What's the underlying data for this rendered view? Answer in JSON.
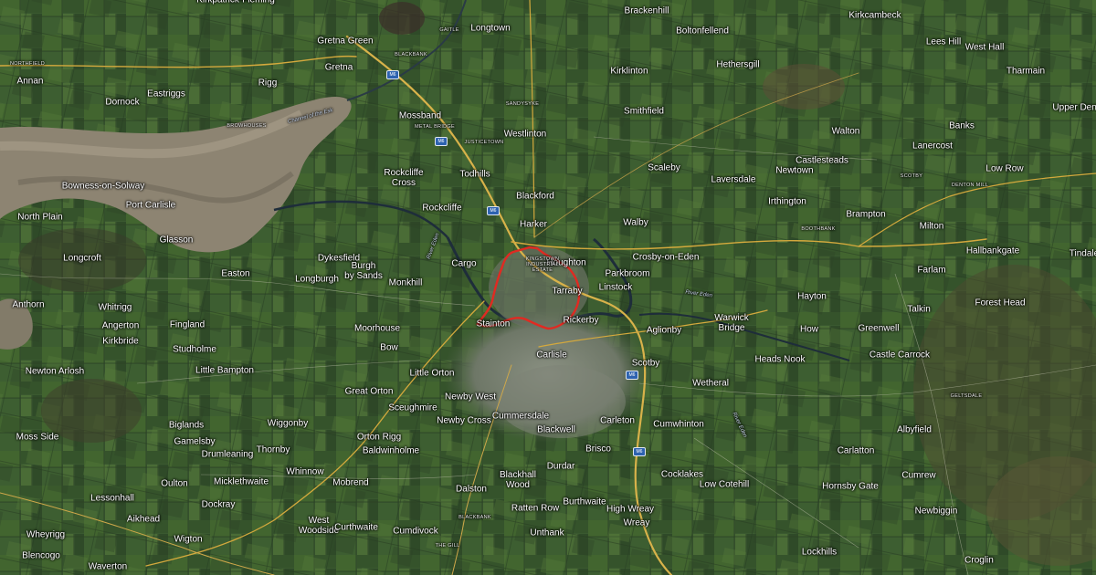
{
  "map": {
    "type": "satellite",
    "colors": {
      "land": "#3b5a32",
      "estuary": "#8c8271",
      "urban": "#7b8275",
      "river": "#1e2d3a",
      "road": "#d8b24a",
      "motorway_shield": "#2d62b0",
      "boundary": "#e02a22"
    },
    "labels": [
      {
        "id": "kirkpatrick-fleming",
        "text": "Kirkpatrick-Fleming"
      },
      {
        "id": "brackenhill",
        "text": "Brackenhill"
      },
      {
        "id": "kirkcambeck",
        "text": "Kirkcambeck"
      },
      {
        "id": "gretna-green",
        "text": "Gretna Green"
      },
      {
        "id": "longtown",
        "text": "Longtown"
      },
      {
        "id": "boltonfellend",
        "text": "Boltonfellend"
      },
      {
        "id": "lees-hill",
        "text": "Lees Hill"
      },
      {
        "id": "west-hall",
        "text": "West Hall"
      },
      {
        "id": "annan",
        "text": "Annan"
      },
      {
        "id": "gretna",
        "text": "Gretna"
      },
      {
        "id": "kirklinton",
        "text": "Kirklinton"
      },
      {
        "id": "hethersgill",
        "text": "Hethersgill"
      },
      {
        "id": "tharmain",
        "text": "Tharmain"
      },
      {
        "id": "dornock",
        "text": "Dornock"
      },
      {
        "id": "eastriggs",
        "text": "Eastriggs"
      },
      {
        "id": "rigg",
        "text": "Rigg"
      },
      {
        "id": "mossband",
        "text": "Mossband"
      },
      {
        "id": "smithfield",
        "text": "Smithfield"
      },
      {
        "id": "upper-dent",
        "text": "Upper Dent"
      },
      {
        "id": "walton",
        "text": "Walton"
      },
      {
        "id": "banks",
        "text": "Banks"
      },
      {
        "id": "westlinton",
        "text": "Westlinton"
      },
      {
        "id": "lanercost",
        "text": "Lanercost"
      },
      {
        "id": "castlesteads",
        "text": "Castlesteads"
      },
      {
        "id": "todhills",
        "text": "Todhills"
      },
      {
        "id": "scaleby",
        "text": "Scaleby"
      },
      {
        "id": "newtown",
        "text": "Newtown"
      },
      {
        "id": "low-row",
        "text": "Low Row"
      },
      {
        "id": "rockcliffe-cross",
        "text": "Rockcliffe\nCross"
      },
      {
        "id": "laversdale",
        "text": "Laversdale"
      },
      {
        "id": "bowness-on-solway",
        "text": "Bowness-on-Solway"
      },
      {
        "id": "blackford",
        "text": "Blackford"
      },
      {
        "id": "irthington",
        "text": "Irthington"
      },
      {
        "id": "port-carlisle",
        "text": "Port Carlisle"
      },
      {
        "id": "rockcliffe",
        "text": "Rockcliffe"
      },
      {
        "id": "north-plain",
        "text": "North Plain"
      },
      {
        "id": "harker",
        "text": "Harker"
      },
      {
        "id": "walby",
        "text": "Walby"
      },
      {
        "id": "brampton",
        "text": "Brampton"
      },
      {
        "id": "milton",
        "text": "Milton"
      },
      {
        "id": "glasson",
        "text": "Glasson"
      },
      {
        "id": "hallbankgate",
        "text": "Hallbankgate"
      },
      {
        "id": "tindale",
        "text": "Tindale"
      },
      {
        "id": "longcroft",
        "text": "Longcroft"
      },
      {
        "id": "dykesfield",
        "text": "Dykesfield"
      },
      {
        "id": "cargo",
        "text": "Cargo"
      },
      {
        "id": "houghton",
        "text": "Houghton"
      },
      {
        "id": "crosby-on-eden",
        "text": "Crosby-on-Eden"
      },
      {
        "id": "easton",
        "text": "Easton"
      },
      {
        "id": "longburgh",
        "text": "Longburgh"
      },
      {
        "id": "burgh-by-sands",
        "text": "Burgh\nby Sands"
      },
      {
        "id": "parkbroom",
        "text": "Parkbroom"
      },
      {
        "id": "farlam",
        "text": "Farlam"
      },
      {
        "id": "monkhill",
        "text": "Monkhill"
      },
      {
        "id": "linstock",
        "text": "Linstock"
      },
      {
        "id": "tarraby",
        "text": "Tarraby"
      },
      {
        "id": "hayton",
        "text": "Hayton"
      },
      {
        "id": "anthorn",
        "text": "Anthorn"
      },
      {
        "id": "whitrigg",
        "text": "Whitrigg"
      },
      {
        "id": "talkin",
        "text": "Talkin"
      },
      {
        "id": "forest-head",
        "text": "Forest Head"
      },
      {
        "id": "angerton",
        "text": "Angerton"
      },
      {
        "id": "fingland",
        "text": "Fingland"
      },
      {
        "id": "stainton",
        "text": "Stainton"
      },
      {
        "id": "rickerby",
        "text": "Rickerby"
      },
      {
        "id": "warwick-bridge",
        "text": "Warwick\nBridge"
      },
      {
        "id": "how",
        "text": "How"
      },
      {
        "id": "greenwell",
        "text": "Greenwell"
      },
      {
        "id": "moorhouse",
        "text": "Moorhouse"
      },
      {
        "id": "aglionby",
        "text": "Aglionby"
      },
      {
        "id": "kirkbride",
        "text": "Kirkbride"
      },
      {
        "id": "carlisle",
        "text": "Carlisle"
      },
      {
        "id": "studholme",
        "text": "Studholme"
      },
      {
        "id": "bow",
        "text": "Bow"
      },
      {
        "id": "castle-carrock",
        "text": "Castle Carrock"
      },
      {
        "id": "heads-nook",
        "text": "Heads Nook"
      },
      {
        "id": "scotby",
        "text": "Scotby"
      },
      {
        "id": "little-bampton",
        "text": "Little Bampton"
      },
      {
        "id": "newton-arlosh",
        "text": "Newton Arlosh"
      },
      {
        "id": "little-orton",
        "text": "Little Orton"
      },
      {
        "id": "wetheral",
        "text": "Wetheral"
      },
      {
        "id": "great-orton",
        "text": "Great Orton"
      },
      {
        "id": "newby-west",
        "text": "Newby West"
      },
      {
        "id": "scuggimire",
        "text": "Sceughmire"
      },
      {
        "id": "cummersdale",
        "text": "Cummersdale"
      },
      {
        "id": "newby-cross",
        "text": "Newby Cross"
      },
      {
        "id": "carleton",
        "text": "Carleton"
      },
      {
        "id": "bigands",
        "text": "Biglands"
      },
      {
        "id": "wiggonby",
        "text": "Wiggonby"
      },
      {
        "id": "blackwell",
        "text": "Blackwell"
      },
      {
        "id": "cumwhinton",
        "text": "Cumwhinton"
      },
      {
        "id": "albyfield",
        "text": "Albyfield"
      },
      {
        "id": "moss-side",
        "text": "Moss Side"
      },
      {
        "id": "orton-rigg",
        "text": "Orton Rigg"
      },
      {
        "id": "gamelsby",
        "text": "Gamelsby"
      },
      {
        "id": "thornby",
        "text": "Thornby"
      },
      {
        "id": "baldwinholme",
        "text": "Baldwinholme"
      },
      {
        "id": "brisco",
        "text": "Brisco"
      },
      {
        "id": "carlatton",
        "text": "Carlatton"
      },
      {
        "id": "drumleaning",
        "text": "Drumleaning"
      },
      {
        "id": "durdar",
        "text": "Durdar"
      },
      {
        "id": "whinnow",
        "text": "Whinnow"
      },
      {
        "id": "cocklakes",
        "text": "Cocklakes"
      },
      {
        "id": "cumrew",
        "text": "Cumrew"
      },
      {
        "id": "oulton",
        "text": "Oulton"
      },
      {
        "id": "micklethwaite",
        "text": "Micklethwaite"
      },
      {
        "id": "mobrend",
        "text": "Mobrend"
      },
      {
        "id": "blackhall-wood",
        "text": "Blackhall\nWood"
      },
      {
        "id": "low-cotehill",
        "text": "Low Cotehill"
      },
      {
        "id": "hornsby-gate",
        "text": "Hornsby Gate"
      },
      {
        "id": "dalston",
        "text": "Dalston"
      },
      {
        "id": "lessonhall",
        "text": "Lessonhall"
      },
      {
        "id": "dockray",
        "text": "Dockray"
      },
      {
        "id": "west-woodside",
        "text": "West\nWoodside"
      },
      {
        "id": "ratten-row",
        "text": "Ratten Row"
      },
      {
        "id": "burthwaite",
        "text": "Burthwaite"
      },
      {
        "id": "high-wreay",
        "text": "High Wreay"
      },
      {
        "id": "newbiggin",
        "text": "Newbiggin"
      },
      {
        "id": "aikhead",
        "text": "Aikhead"
      },
      {
        "id": "curthwaite",
        "text": "Curthwaite"
      },
      {
        "id": "wreay",
        "text": "Wreay"
      },
      {
        "id": "whyrigg",
        "text": "Wheyrigg"
      },
      {
        "id": "cumdivock",
        "text": "Cumdivock"
      },
      {
        "id": "unthank",
        "text": "Unthank"
      },
      {
        "id": "wigton",
        "text": "Wigton"
      },
      {
        "id": "blencogo",
        "text": "Blencogo"
      },
      {
        "id": "lockhills",
        "text": "Lockhills"
      },
      {
        "id": "croglin",
        "text": "Croglin"
      },
      {
        "id": "waverton",
        "text": "Waverton"
      }
    ],
    "small_labels": [
      {
        "id": "northfield",
        "text": "NORTHFIELD"
      },
      {
        "id": "gaitle",
        "text": "GAITLE"
      },
      {
        "id": "blackbank",
        "text": "BLACKBANK"
      },
      {
        "id": "brow-houses",
        "text": "BROWHOUSES"
      },
      {
        "id": "metal-bridge",
        "text": "METAL BRIDGE"
      },
      {
        "id": "sandysyke",
        "text": "SANDYSYKE"
      },
      {
        "id": "justicetown",
        "text": "JUSTICETOWN"
      },
      {
        "id": "scotby-north",
        "text": "SCOTBY"
      },
      {
        "id": "denton-mill",
        "text": "DENTON MILL"
      },
      {
        "id": "boothbank",
        "text": "BOOTHBANK"
      },
      {
        "id": "kingstown",
        "text": "KINGSTOWN\nINDUSTRIAL\nESTATE"
      },
      {
        "id": "geltsdale",
        "text": "GELTSDALE"
      },
      {
        "id": "blackbank-s",
        "text": "BLACKBANK"
      },
      {
        "id": "the-gill",
        "text": "THE GILL"
      }
    ],
    "water_labels": [
      {
        "id": "river-eden-north",
        "text": "River Eden"
      },
      {
        "id": "river-eden-east",
        "text": "River Eden"
      },
      {
        "id": "river-eden-south",
        "text": "River Eden"
      },
      {
        "id": "channel",
        "text": "Channel of the Esk"
      }
    ],
    "motorway_shields": [
      {
        "id": "m6-a",
        "text": "M6"
      },
      {
        "id": "m6-b",
        "text": "M6"
      },
      {
        "id": "m6-c",
        "text": "M6"
      },
      {
        "id": "m6-d",
        "text": "M6"
      },
      {
        "id": "m6-e",
        "text": "M6"
      }
    ]
  }
}
